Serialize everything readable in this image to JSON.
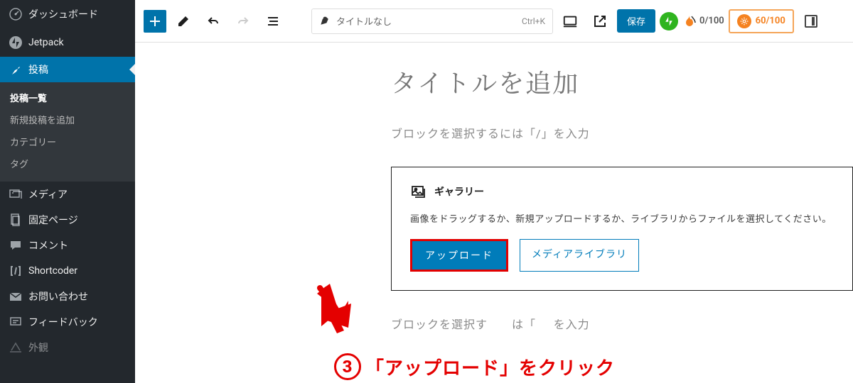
{
  "sidebar": {
    "items": [
      {
        "label": "ダッシュボード",
        "icon": "dashboard-icon"
      },
      {
        "label": "Jetpack",
        "icon": "jetpack-icon"
      },
      {
        "label": "投稿",
        "icon": "pin-icon",
        "active": true
      },
      {
        "label": "メディア",
        "icon": "media-icon"
      },
      {
        "label": "固定ページ",
        "icon": "page-icon"
      },
      {
        "label": "コメント",
        "icon": "comment-icon"
      },
      {
        "label": "Shortcoder",
        "icon": "shortcoder-icon"
      },
      {
        "label": "お問い合わせ",
        "icon": "mail-icon"
      },
      {
        "label": "フィードバック",
        "icon": "feedback-icon"
      },
      {
        "label": "外観",
        "icon": "appearance-icon"
      }
    ],
    "submenu": [
      {
        "label": "投稿一覧",
        "current": true
      },
      {
        "label": "新規投稿を追加"
      },
      {
        "label": "カテゴリー"
      },
      {
        "label": "タグ"
      }
    ]
  },
  "topbar": {
    "title_placeholder": "タイトルなし",
    "kbd_hint": "Ctrl+K",
    "save_label": "保存",
    "seo1_score": "0/100",
    "seo2_score": "60/100"
  },
  "editor": {
    "title_placeholder": "タイトルを追加",
    "block_placeholder": "ブロックを選択するには「/」を入力",
    "gallery": {
      "heading": "ギャラリー",
      "description": "画像をドラッグするか、新規アップロードするか、ライブラリからファイルを選択してください。",
      "upload_label": "アップロード",
      "media_label": "メディアライブラリ"
    },
    "block_placeholder2_pre": "ブロックを選択す",
    "block_placeholder2_post": "は「",
    "block_placeholder2_end": "を入力"
  },
  "annotation": {
    "step_number": "3",
    "text": "「アップロード」をクリック"
  }
}
